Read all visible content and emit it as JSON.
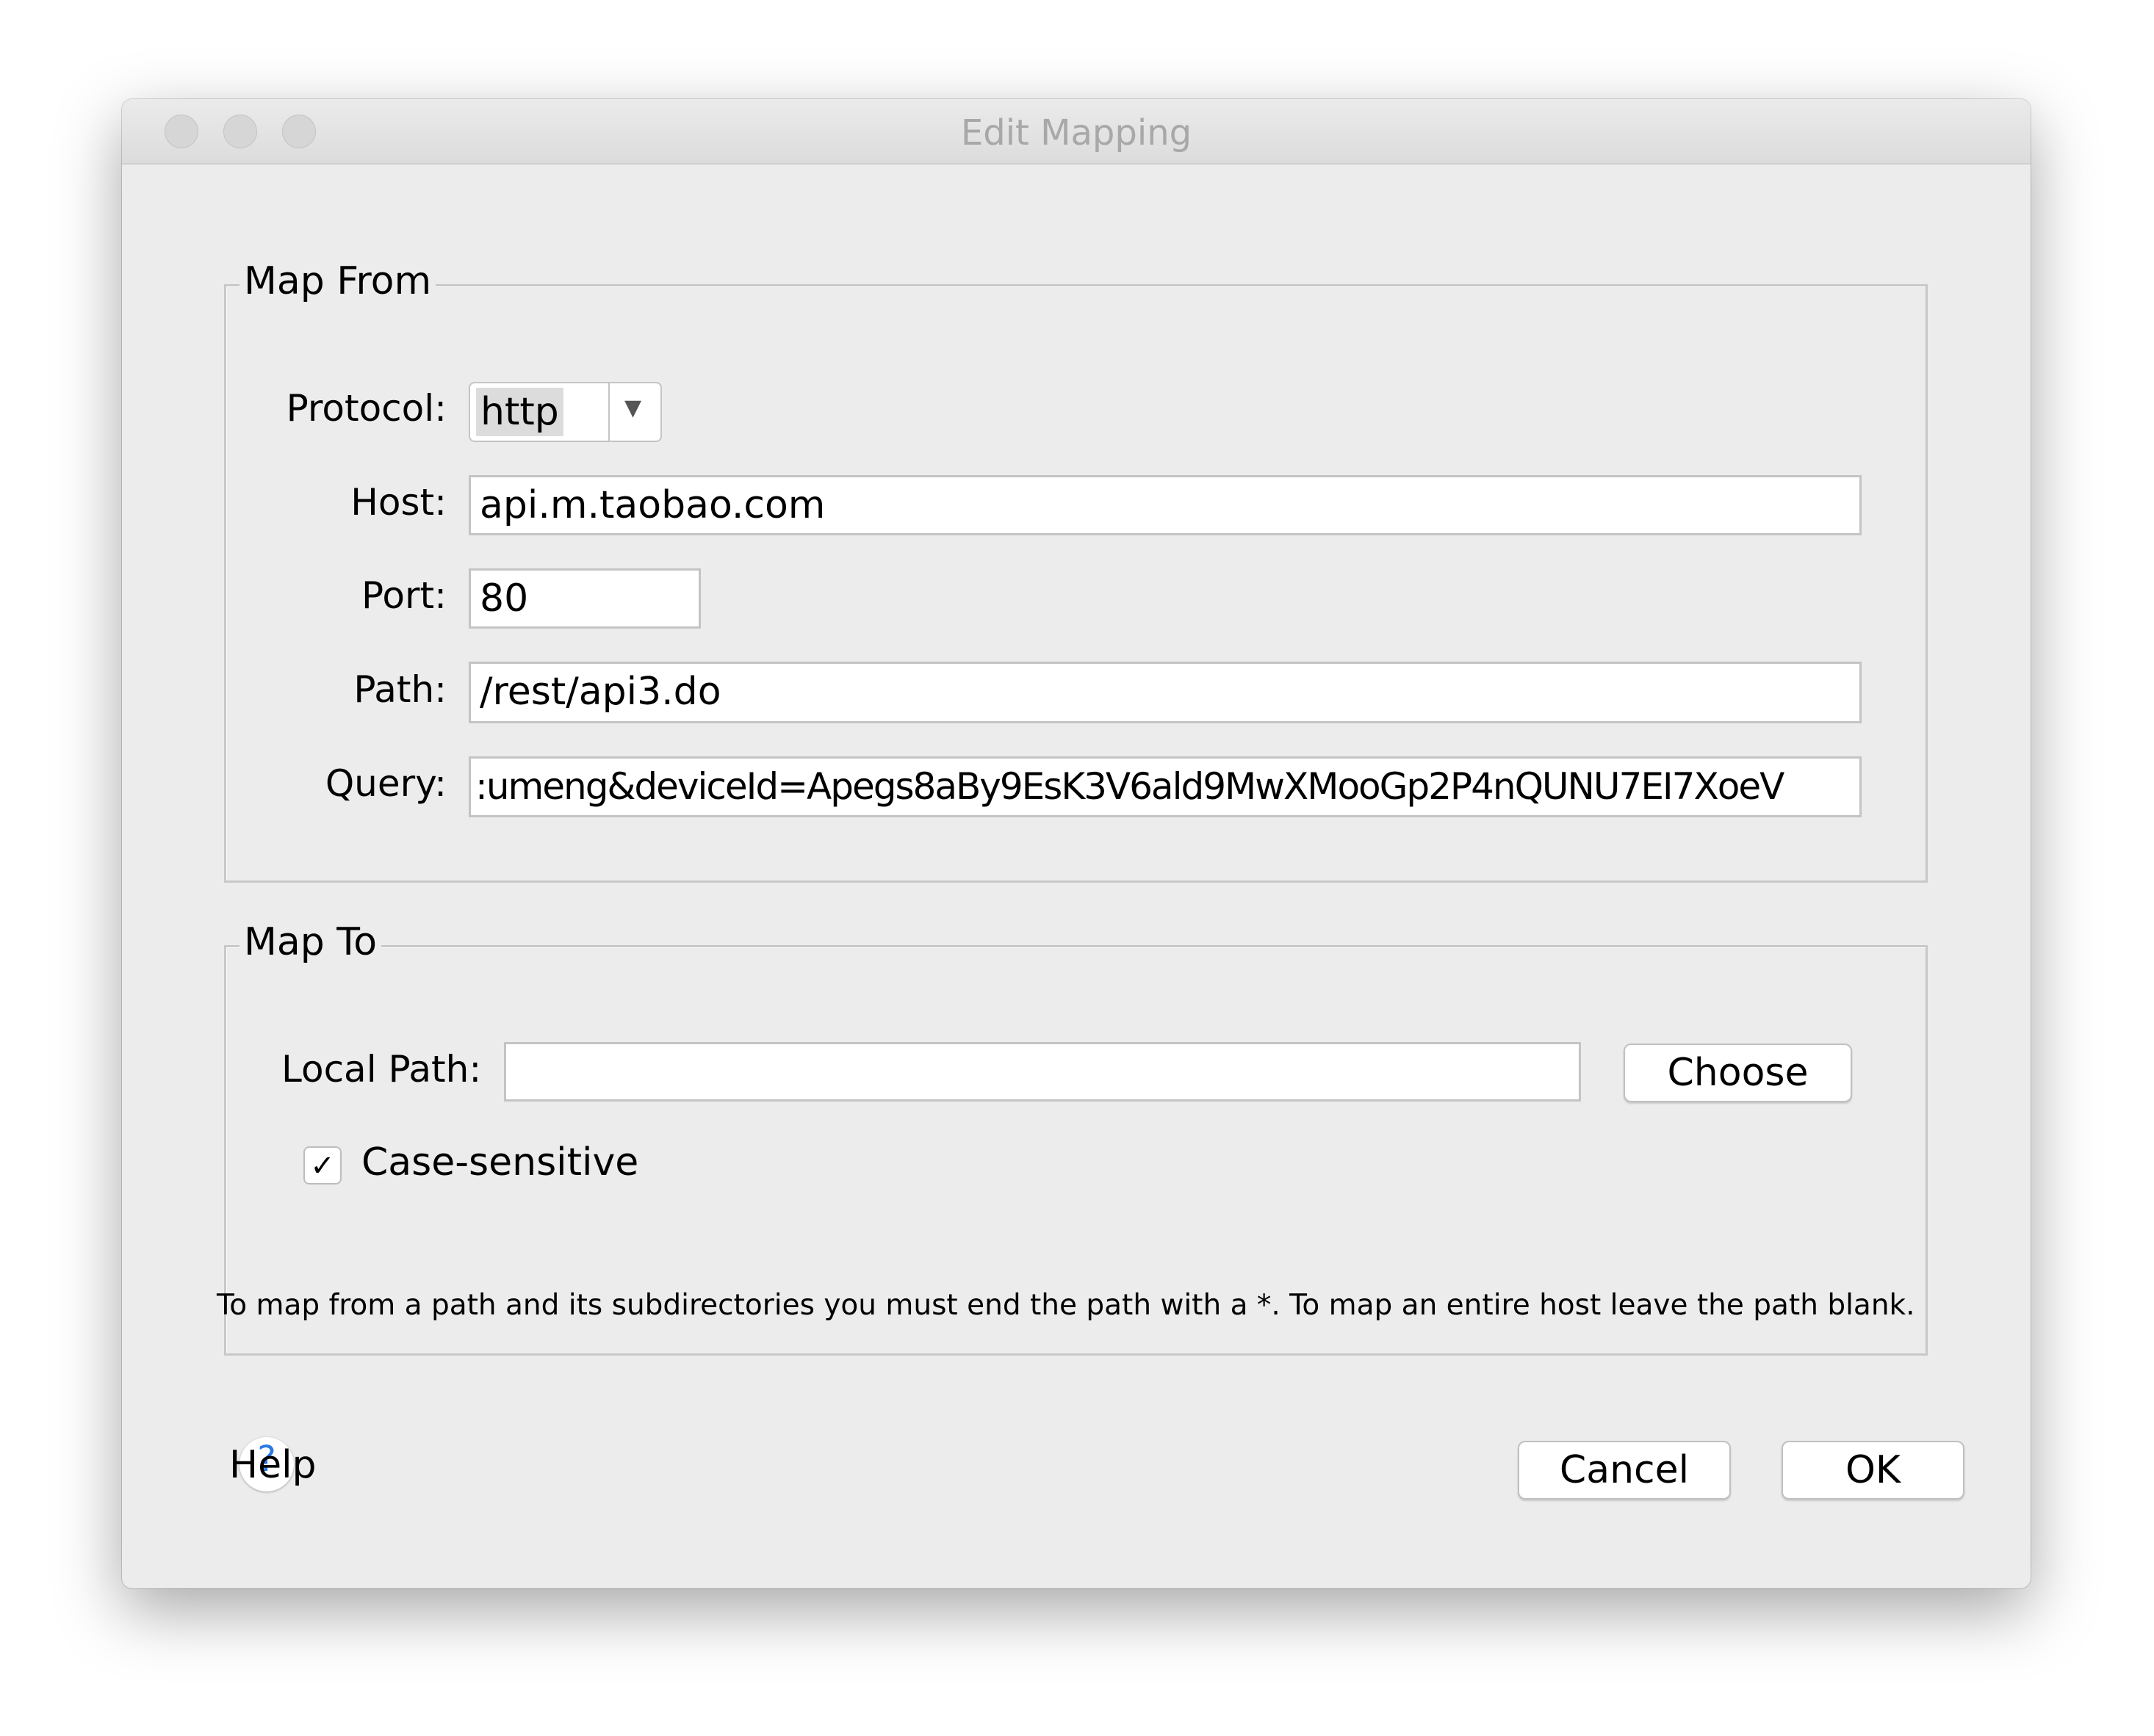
{
  "window": {
    "title": "Edit Mapping"
  },
  "map_from": {
    "legend": "Map From",
    "protocol": {
      "label": "Protocol:",
      "value": "http"
    },
    "host": {
      "label": "Host:",
      "value": "api.m.taobao.com"
    },
    "port": {
      "label": "Port:",
      "value": "80"
    },
    "path": {
      "label": "Path:",
      "value": "/rest/api3.do"
    },
    "query": {
      "label": "Query:",
      "value": ":umeng&deviceId=Apegs8aBy9EsK3V6ald9MwXMooGp2P4nQUNU7EI7XoeV"
    }
  },
  "map_to": {
    "legend": "Map To",
    "local_path": {
      "label": "Local Path:",
      "value": ""
    },
    "choose_label": "Choose",
    "case_sensitive": {
      "label": "Case-sensitive",
      "checked": true
    }
  },
  "hint": "To map from a path and its subdirectories you must end the path with a *. To map an entire host leave the path blank.",
  "footer": {
    "help_label": "Help",
    "cancel_label": "Cancel",
    "ok_label": "OK"
  }
}
